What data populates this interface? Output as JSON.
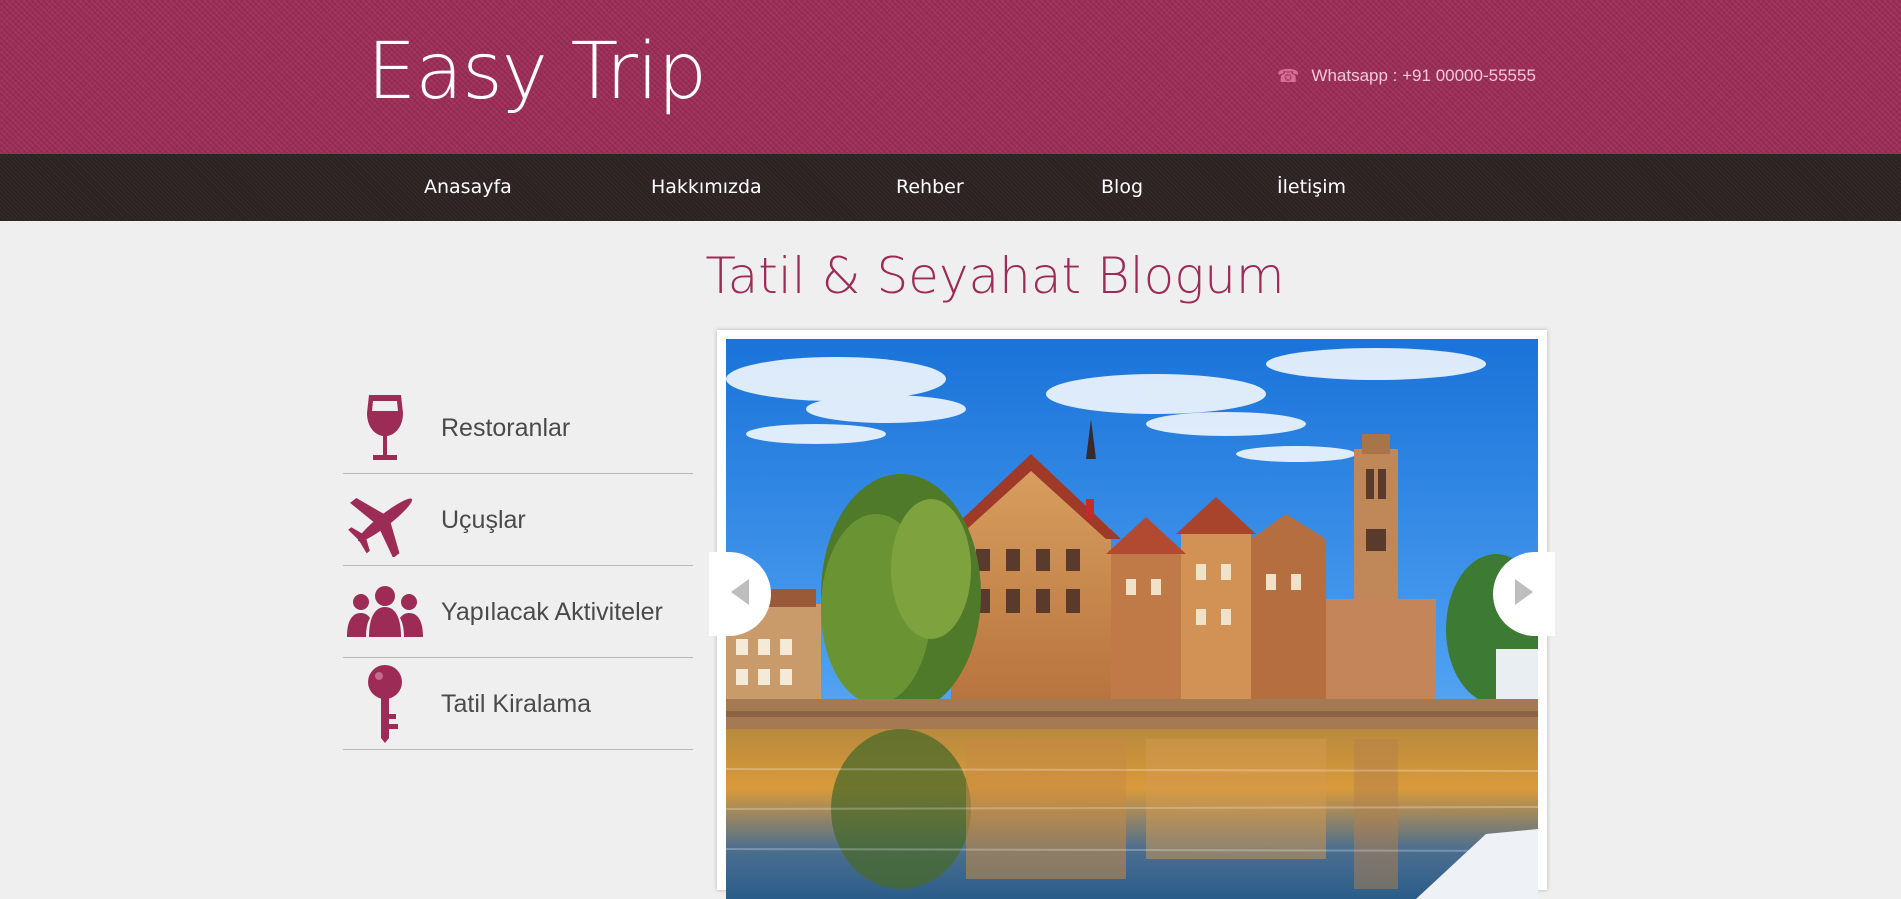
{
  "header": {
    "logo": "Easy Trip",
    "contact_text": "Whatsapp : +91 00000-55555",
    "contact_icon": "phone-icon"
  },
  "nav": {
    "items": [
      "Anasayfa",
      "Hakkımızda",
      "Rehber",
      "Blog",
      "İletişim"
    ]
  },
  "main": {
    "title": "Tatil & Seyahat Blogum"
  },
  "sidebar": {
    "items": [
      {
        "label": "Restoranlar",
        "icon": "wine-glass-icon"
      },
      {
        "label": "Uçuşlar",
        "icon": "airplane-icon"
      },
      {
        "label": "Yapılacak Aktiviteler",
        "icon": "people-group-icon"
      },
      {
        "label": "Tatil Kiralama",
        "icon": "key-icon"
      }
    ]
  },
  "slider": {
    "image": "canal-town-photo",
    "prev_icon": "chevron-left-icon",
    "next_icon": "chevron-right-icon"
  },
  "colors": {
    "brand": "#9c2c55",
    "nav_bg": "#2f2424",
    "page_bg": "#efefef"
  }
}
